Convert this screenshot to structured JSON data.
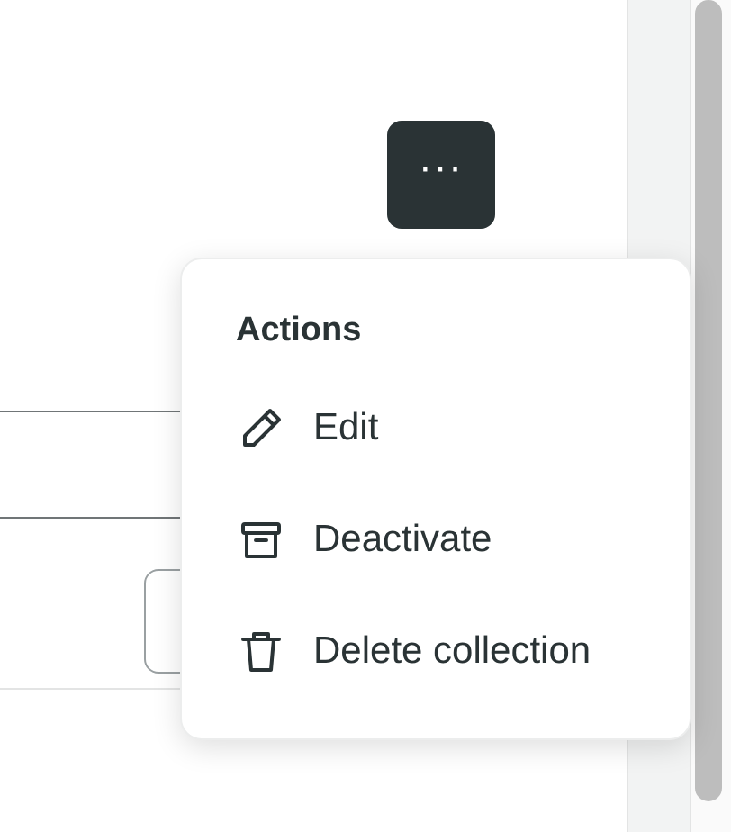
{
  "more_button": {
    "label": "···"
  },
  "menu": {
    "title": "Actions",
    "items": [
      {
        "kind": "edit",
        "label": "Edit"
      },
      {
        "kind": "archive",
        "label": "Deactivate"
      },
      {
        "kind": "delete",
        "label": "Delete collection"
      }
    ]
  }
}
